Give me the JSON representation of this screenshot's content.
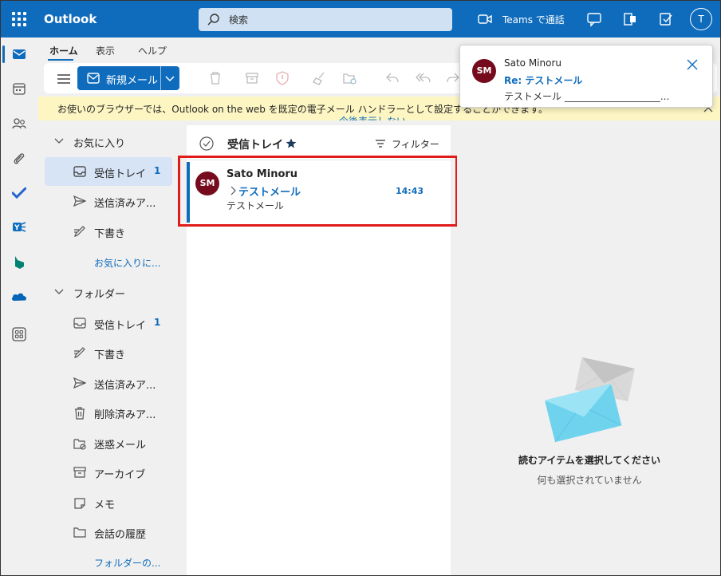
{
  "app": {
    "title": "Outlook"
  },
  "search": {
    "placeholder": "検索"
  },
  "topbar": {
    "teams_label": "Teams で通話",
    "avatar_initial": "T"
  },
  "ribbon": {
    "tabs": [
      "ホーム",
      "表示",
      "ヘルプ"
    ],
    "new_mail": "新規メール"
  },
  "banner": {
    "text": "お使いのブラウザーでは、Outlook on the web を既定の電子メール ハンドラーとして設定することができます。",
    "link": "今後表示しない"
  },
  "folders": {
    "favorites_header": "お気に入り",
    "favorites": [
      {
        "label": "受信トレイ",
        "count": "1"
      },
      {
        "label": "送信済みア...",
        "count": ""
      },
      {
        "label": "下書き",
        "count": ""
      }
    ],
    "favorites_add": "お気に入りに...",
    "folders_header": "フォルダー",
    "items": [
      {
        "label": "受信トレイ",
        "count": "1"
      },
      {
        "label": "下書き",
        "count": ""
      },
      {
        "label": "送信済みア...",
        "count": ""
      },
      {
        "label": "削除済みア...",
        "count": ""
      },
      {
        "label": "迷惑メール",
        "count": ""
      },
      {
        "label": "アーカイブ",
        "count": ""
      },
      {
        "label": "メモ",
        "count": ""
      },
      {
        "label": "会話の履歴",
        "count": ""
      }
    ],
    "folders_more": "フォルダーの..."
  },
  "list": {
    "title": "受信トレイ",
    "filter": "フィルター",
    "messages": [
      {
        "initials": "SM",
        "from": "Sato Minoru",
        "subject": "テストメール",
        "time": "14:43",
        "preview": "テストメール"
      }
    ]
  },
  "reading": {
    "empty_title": "読むアイテムを選択してください",
    "empty_sub": "何も選択されていません"
  },
  "notification": {
    "initials": "SM",
    "from": "Sato Minoru",
    "subject": "Re: テストメール",
    "preview": "テストメール ____________________..."
  },
  "colors": {
    "accent": "#0f6cbd",
    "avatar": "#750b1c",
    "highlight": "#e11a1a",
    "banner": "#fdf6c3"
  }
}
